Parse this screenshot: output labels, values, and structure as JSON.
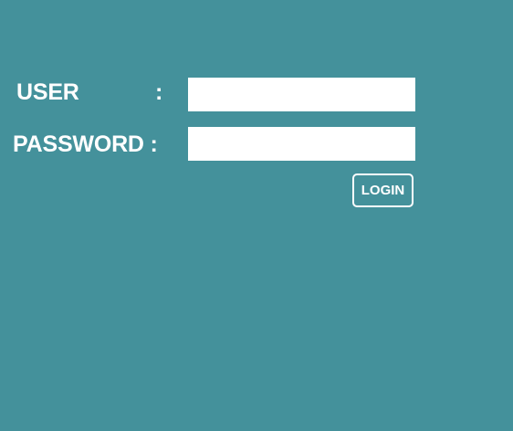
{
  "login_form": {
    "user_label": "USER",
    "user_colon": ":",
    "password_label": "PASSWORD :",
    "user_value": "",
    "password_value": "",
    "login_button_label": "LOGIN"
  },
  "colors": {
    "background": "#44919b",
    "text": "#ffffff",
    "input_background": "#ffffff"
  }
}
